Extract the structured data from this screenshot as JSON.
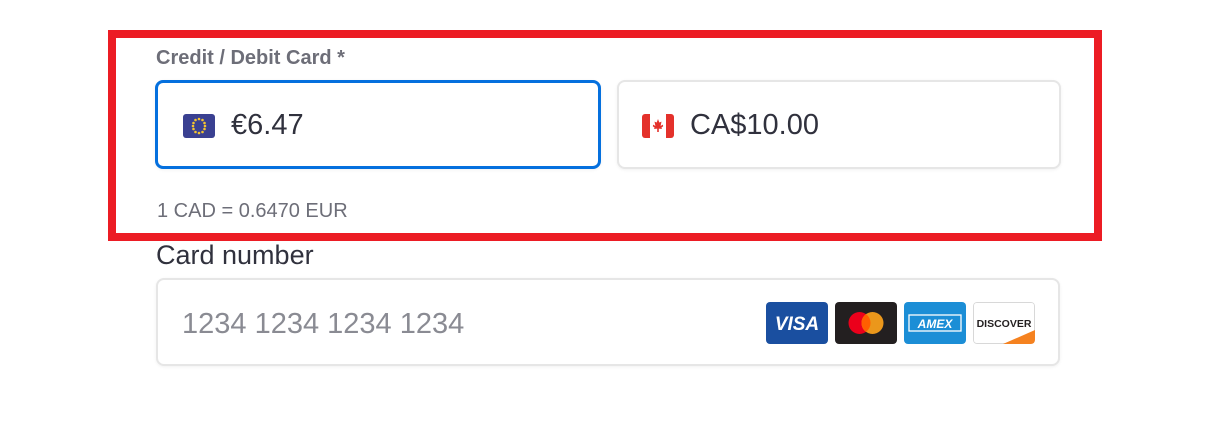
{
  "section": {
    "label": "Credit / Debit Card *"
  },
  "currency": {
    "eur": {
      "flag_icon": "eu-flag-icon",
      "amount": "€6.47"
    },
    "cad": {
      "flag_icon": "canada-flag-icon",
      "amount": "CA$10.00"
    },
    "rate_text": "1 CAD = 0.6470 EUR"
  },
  "card": {
    "label": "Card number",
    "placeholder": "1234 1234 1234 1234",
    "brands": [
      {
        "name": "VISA",
        "icon": "visa-icon",
        "color": "#1a4fa0"
      },
      {
        "name": "Mastercard",
        "icon": "mastercard-icon",
        "color": "#231f20"
      },
      {
        "name": "AMEX",
        "icon": "amex-icon",
        "color": "#1c8ed6"
      },
      {
        "name": "DISCOVER",
        "icon": "discover-icon",
        "color": "#f58220"
      }
    ]
  },
  "colors": {
    "focus_border": "#0570de",
    "highlight": "#ec1c24"
  }
}
